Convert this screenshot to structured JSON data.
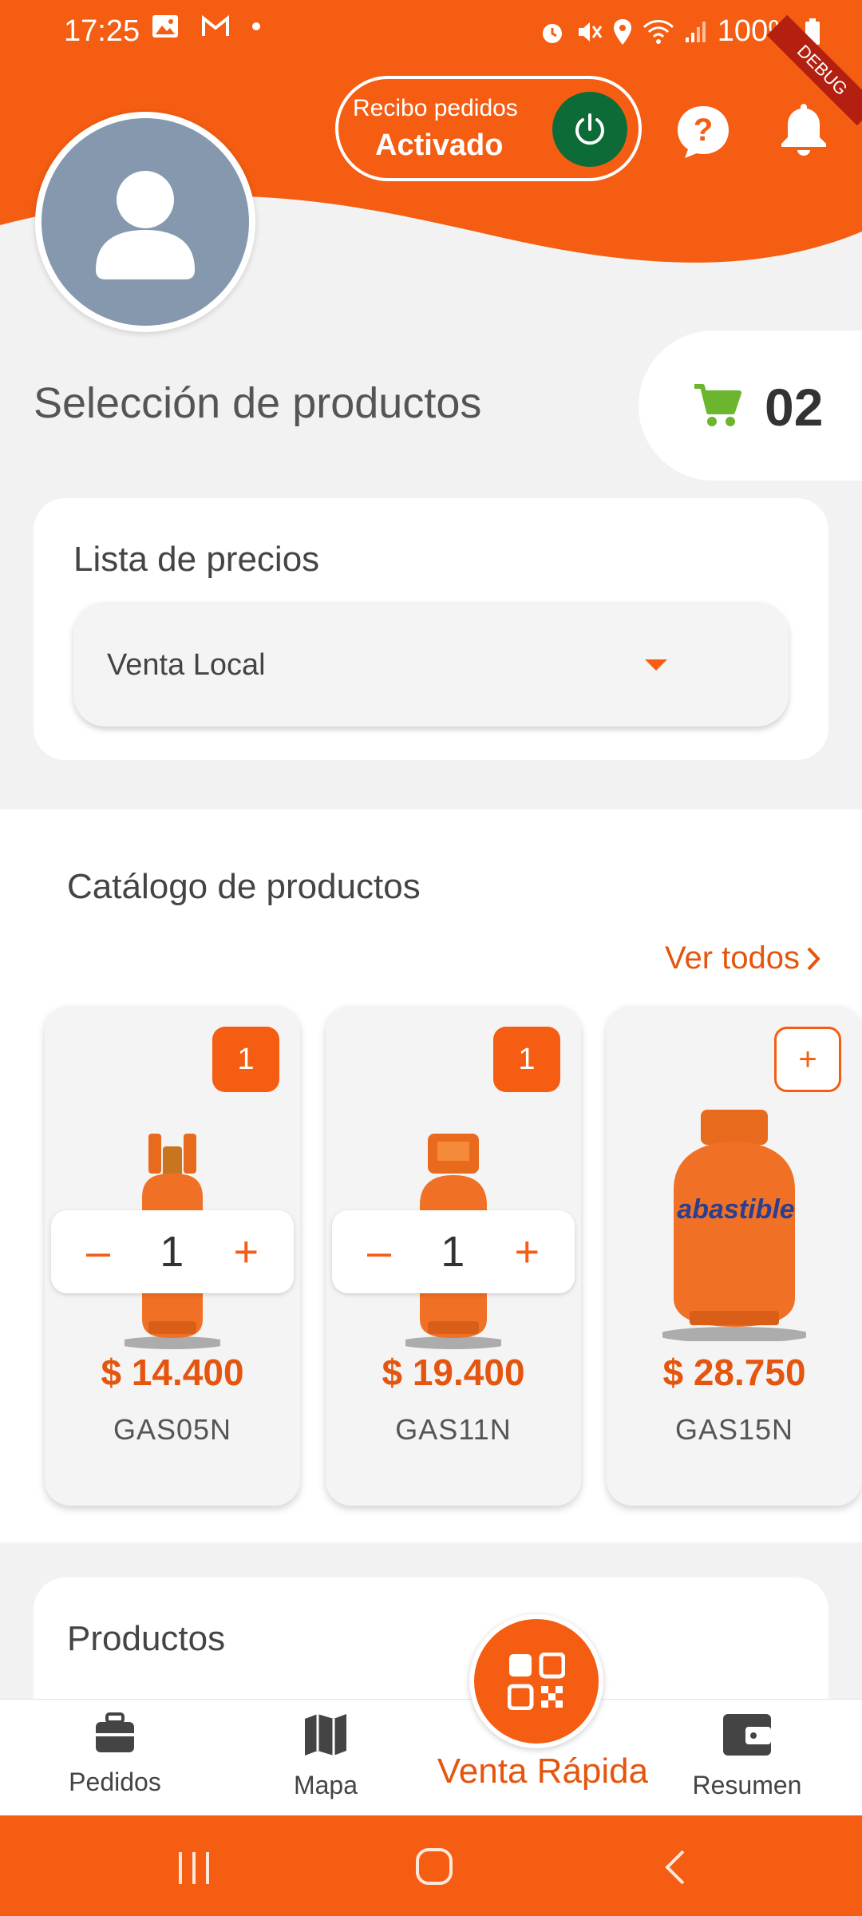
{
  "status_bar": {
    "time": "17:25",
    "battery": "100%"
  },
  "header": {
    "recibo_label": "Recibo pedidos",
    "recibo_state": "Activado",
    "debug_ribbon": "DEBUG"
  },
  "cart": {
    "count": "02"
  },
  "section_title": "Selección de productos",
  "price_list": {
    "label": "Lista de precios",
    "selected": "Venta Local"
  },
  "catalog": {
    "title": "Catálogo de productos",
    "see_all": "Ver todos",
    "products": [
      {
        "badge": "1",
        "qty": "1",
        "price": "$ 14.400",
        "code": "GAS05N"
      },
      {
        "badge": "1",
        "qty": "1",
        "price": "$ 19.400",
        "code": "GAS11N"
      },
      {
        "badge": "+",
        "price": "$ 28.750",
        "code": "GAS15N",
        "brand": "abastible"
      }
    ]
  },
  "productos": {
    "title": "Productos"
  },
  "bottom_nav": {
    "pedidos": "Pedidos",
    "mapa": "Mapa",
    "venta_rapida": "Venta Rápida",
    "resumen": "Resumen"
  },
  "colors": {
    "brand_orange": "#f45d12",
    "power_green": "#0d6b37",
    "avatar_bg": "#8598ad"
  }
}
